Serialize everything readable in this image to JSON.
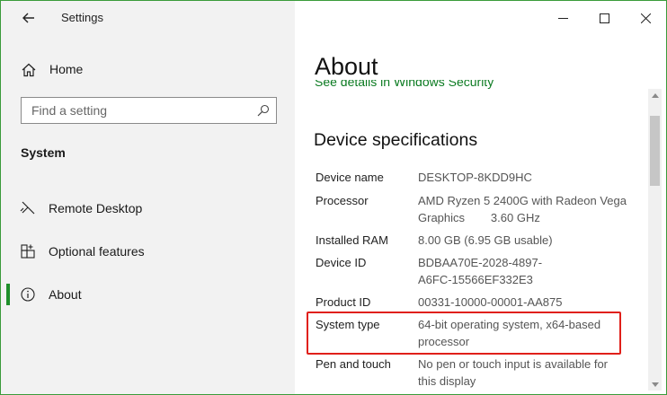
{
  "window": {
    "title": "Settings"
  },
  "sidebar": {
    "home_label": "Home",
    "search": {
      "placeholder": "Find a setting"
    },
    "section_label": "System",
    "items": [
      {
        "label": "Remote Desktop",
        "icon": "remote-desktop-icon",
        "selected": false
      },
      {
        "label": "Optional features",
        "icon": "optional-features-icon",
        "selected": false
      },
      {
        "label": "About",
        "icon": "info-icon",
        "selected": true
      }
    ]
  },
  "content": {
    "title": "About",
    "partial_link": "See details in Windows Security",
    "specs_title": "Device specifications",
    "specs": [
      {
        "key": "Device name",
        "value_lines": [
          "DESKTOP-8KDD9HC"
        ]
      },
      {
        "key": "Processor",
        "value_lines": [
          "AMD Ryzen 5 2400G with Radeon Vega",
          "Graphics        3.60 GHz"
        ]
      },
      {
        "key": "Installed RAM",
        "value_lines": [
          "8.00 GB (6.95 GB usable)"
        ]
      },
      {
        "key": "Device ID",
        "value_lines": [
          "BDBAA70E-2028-4897-",
          "A6FC-15566EF332E3"
        ]
      },
      {
        "key": "Product ID",
        "value_lines": [
          "00331-10000-00001-AA875"
        ]
      },
      {
        "key": "System type",
        "value_lines": [
          "64-bit operating system, x64-based",
          "processor"
        ]
      },
      {
        "key": "Pen and touch",
        "value_lines": [
          "No pen or touch input is available for",
          "this display"
        ]
      }
    ]
  },
  "colors": {
    "accent": "#1f8f2b",
    "highlight_border": "#e0201a",
    "link": "#0a7a20",
    "window_border": "#3a9b3a"
  }
}
